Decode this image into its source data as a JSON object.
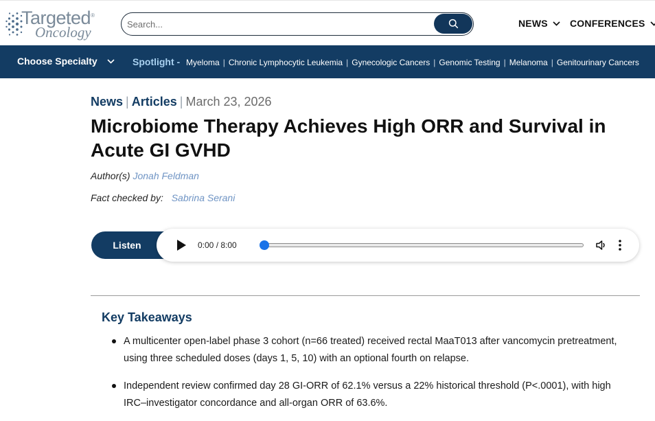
{
  "logo": {
    "line1": "Targeted",
    "line2": "Oncology",
    "mark": "®"
  },
  "search": {
    "placeholder": "Search...",
    "button_icon": "search-icon"
  },
  "top_nav": [
    {
      "label": "NEWS"
    },
    {
      "label": "CONFERENCES"
    }
  ],
  "blue_nav": {
    "choose_specialty": "Choose Specialty",
    "spotlight_label": "Spotlight -",
    "links": [
      "Myeloma",
      "Chronic Lymphocytic Leukemia",
      "Gynecologic Cancers",
      "Genomic Testing",
      "Melanoma",
      "Genitourinary Cancers"
    ],
    "separator": "|"
  },
  "article": {
    "breadcrumb": [
      "News",
      "Articles"
    ],
    "breadcrumb_sep": "|",
    "date": "March 23, 2026",
    "title": "Microbiome Therapy Achieves High ORR and Survival in Acute GI GVHD",
    "author_label": "Author(s)",
    "author": "Jonah Feldman",
    "fact_check_label": "Fact checked by:",
    "fact_checker": "Sabrina Serani"
  },
  "audio": {
    "listen_label": "Listen",
    "time": "0:00 / 8:00",
    "progress": 0,
    "play_icon": "play-icon",
    "volume_icon": "volume-icon",
    "more_icon": "more-vertical-icon"
  },
  "takeaways": {
    "title": "Key Takeaways",
    "items": [
      "A multicenter open-label phase 3 cohort (n=66 treated) received rectal MaaT013 after vancomycin pretreatment, using three scheduled doses (days 1, 5, 10) with an optional fourth on relapse.",
      "Independent review confirmed day 28 GI-ORR of 62.1% versus a 22% historical threshold (P<.0001), with high IRC–investigator concordance and all-organ ORR of 63.6%."
    ]
  },
  "colors": {
    "brand_navy": "#133c63",
    "spotlight_accent": "#a9d1f0",
    "link_blue": "#6f94c4",
    "player_thumb": "#1a73e8"
  }
}
